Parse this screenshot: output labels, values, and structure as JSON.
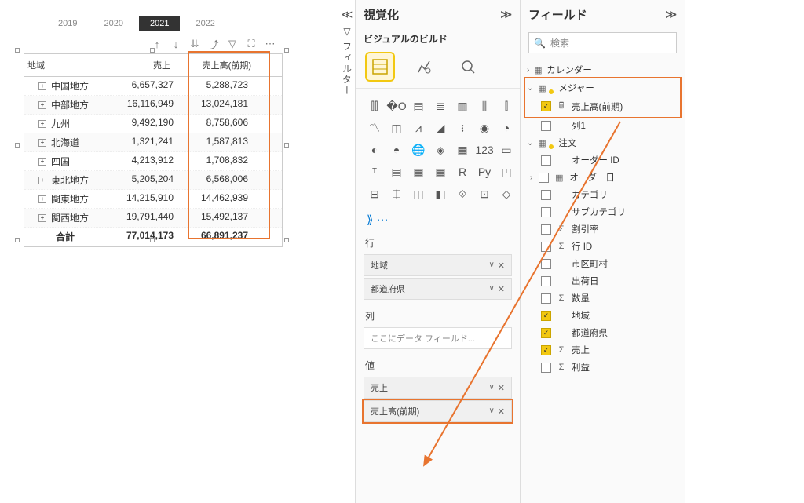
{
  "matrix": {
    "tabs": [
      "2019",
      "2020",
      "2021",
      "2022"
    ],
    "active_tab": "2021",
    "columns": [
      "地域",
      "売上",
      "売上高(前期)"
    ],
    "rows": [
      {
        "region": "中国地方",
        "sales": "6,657,327",
        "prev": "5,288,723"
      },
      {
        "region": "中部地方",
        "sales": "16,116,949",
        "prev": "13,024,181"
      },
      {
        "region": "九州",
        "sales": "9,492,190",
        "prev": "8,758,606"
      },
      {
        "region": "北海道",
        "sales": "1,321,241",
        "prev": "1,587,813"
      },
      {
        "region": "四国",
        "sales": "4,213,912",
        "prev": "1,708,832"
      },
      {
        "region": "東北地方",
        "sales": "5,205,204",
        "prev": "6,568,006"
      },
      {
        "region": "関東地方",
        "sales": "14,215,910",
        "prev": "14,462,939"
      },
      {
        "region": "関西地方",
        "sales": "19,791,440",
        "prev": "15,492,137"
      }
    ],
    "total": {
      "label": "合計",
      "sales": "77,014,173",
      "prev": "66,891,237"
    }
  },
  "filter_label": "フィルター",
  "viz": {
    "title": "視覚化",
    "subtitle": "ビジュアルのビルド",
    "sections": {
      "rows": "行",
      "cols": "列",
      "vals": "値"
    },
    "row_wells": [
      "地域",
      "都道府県"
    ],
    "col_placeholder": "ここにデータ フィールド...",
    "val_wells": [
      "売上",
      "売上高(前期)"
    ]
  },
  "fields": {
    "title": "フィールド",
    "search_placeholder": "検索",
    "tables": {
      "calendar": "カレンダー",
      "measure": "メジャー",
      "measure_items": [
        {
          "label": "売上高(前期)",
          "checked": true,
          "icon": "calc"
        },
        {
          "label": "列1",
          "checked": false,
          "icon": ""
        }
      ],
      "order": "注文",
      "order_items": [
        {
          "label": "オーダー ID",
          "checked": false,
          "icon": ""
        },
        {
          "label": "オーダー日",
          "checked": false,
          "icon": "date",
          "expandable": true
        },
        {
          "label": "カテゴリ",
          "checked": false,
          "icon": ""
        },
        {
          "label": "サブカテゴリ",
          "checked": false,
          "icon": ""
        },
        {
          "label": "割引率",
          "checked": false,
          "icon": "sum"
        },
        {
          "label": "行 ID",
          "checked": false,
          "icon": "sum"
        },
        {
          "label": "市区町村",
          "checked": false,
          "icon": ""
        },
        {
          "label": "出荷日",
          "checked": false,
          "icon": ""
        },
        {
          "label": "数量",
          "checked": false,
          "icon": "sum"
        },
        {
          "label": "地域",
          "checked": true,
          "icon": ""
        },
        {
          "label": "都道府県",
          "checked": true,
          "icon": ""
        },
        {
          "label": "売上",
          "checked": true,
          "icon": "sum"
        },
        {
          "label": "利益",
          "checked": false,
          "icon": "sum"
        }
      ]
    }
  }
}
